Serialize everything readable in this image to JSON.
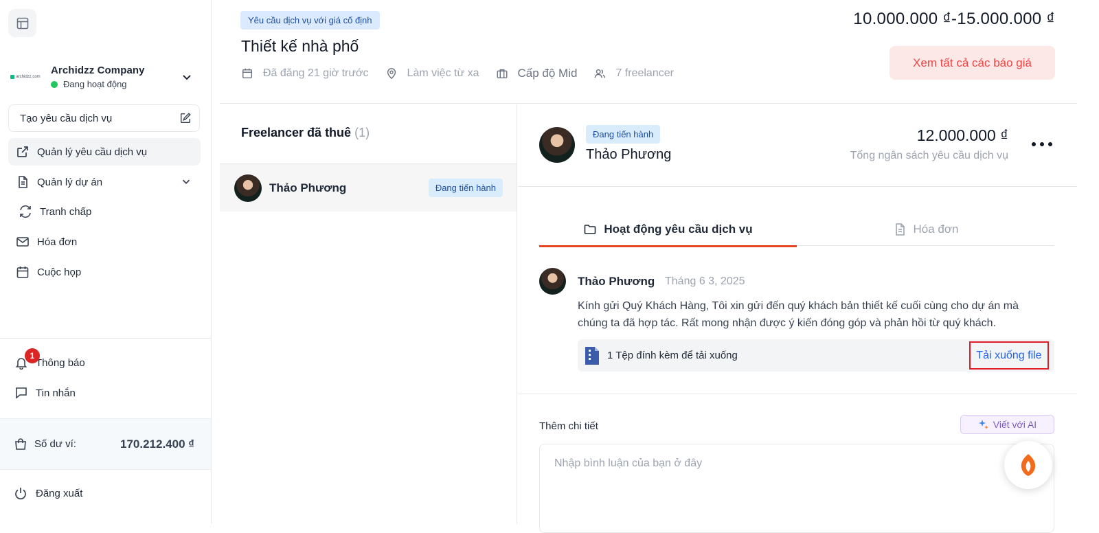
{
  "company": {
    "name": "Archidzz Company",
    "status": "Đang hoạt động",
    "logo_text": "archidzz.com"
  },
  "sidebar": {
    "create_request": "Tạo yêu cầu dịch vụ",
    "items": [
      {
        "label": "Quản lý yêu cầu dịch vụ",
        "icon": "external-link-icon",
        "active": true
      },
      {
        "label": "Quản lý dự án",
        "icon": "document-icon"
      },
      {
        "label": "Tranh chấp",
        "icon": "refresh-icon"
      },
      {
        "label": "Hóa đơn",
        "icon": "mail-icon"
      },
      {
        "label": "Cuộc họp",
        "icon": "calendar-icon"
      }
    ],
    "notifications": {
      "label": "Thông báo",
      "badge": "1"
    },
    "messages": {
      "label": "Tin nhắn"
    },
    "wallet": {
      "label": "Số dư ví:",
      "value": "170.212.400 ₫"
    },
    "logout": "Đăng xuất"
  },
  "header": {
    "type_chip": "Yêu cầu dịch vụ với giá cố định",
    "title": "Thiết kế nhà phố",
    "meta": {
      "posted": "Đã đăng 21 giờ trước",
      "location": "Làm việc từ xa",
      "level": "Cấp độ Mid",
      "freelancers": "7 freelancer"
    },
    "price_range": "10.000.000 ₫-15.000.000 ₫",
    "all_quotes_button": "Xem tất cả các báo giá"
  },
  "hired": {
    "title": "Freelancer đã thuê",
    "count": "(1)",
    "rows": [
      {
        "name": "Thảo Phương",
        "status": "Đang tiến hành"
      }
    ]
  },
  "detail": {
    "status": "Đang tiến hành",
    "name": "Thảo Phương",
    "budget": "12.000.000 ₫",
    "budget_label": "Tổng ngân sách yêu cầu dịch vụ",
    "tabs": [
      {
        "label": "Hoạt động yêu cầu dịch vụ",
        "active": true
      },
      {
        "label": "Hóa đơn",
        "active": false
      }
    ],
    "activity": {
      "author": "Thảo Phương",
      "date": "Tháng 6 3, 2025",
      "message": "Kính gửi Quý Khách Hàng, Tôi xin gửi đến quý khách bản thiết kế cuối cùng cho dự án mà chúng ta đã hợp tác. Rất mong nhận được ý kiến đóng góp và phản hồi từ quý khách.",
      "attachment": "1 Tệp đính kèm để tải xuống",
      "download": "Tải xuống file"
    },
    "more_detail_label": "Thêm chi tiết",
    "ai_button": "Viết với AI",
    "comment_placeholder": "Nhập bình luận của bạn ở đây"
  },
  "colors": {
    "accent": "#e5461f",
    "link": "#2563eb",
    "chip_bg": "#dbeafe",
    "danger": "#ef4444"
  }
}
